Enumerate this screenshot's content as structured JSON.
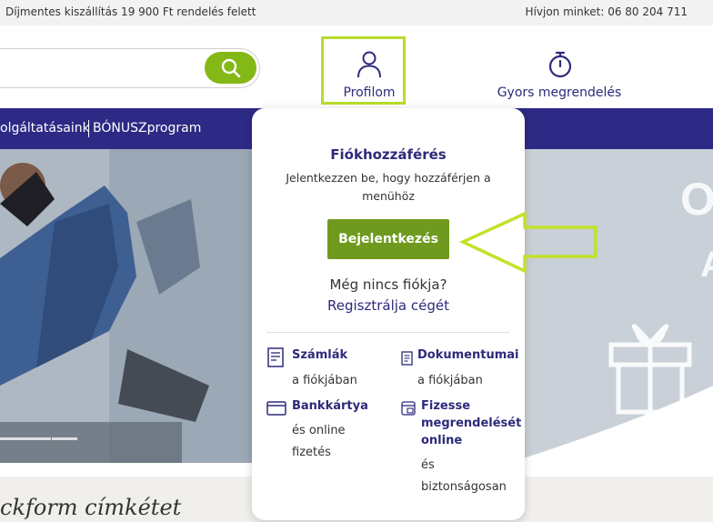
{
  "topbar": {
    "shipping": "Díjmentes kiszállítás 19 900 Ft rendelés felett",
    "phone": "Hívjon minket: 06 80 204 711"
  },
  "header": {
    "profile_label": "Profilom",
    "quick_order_label": "Gyors megrendelés"
  },
  "nav": {
    "item1": "olgáltatásaink",
    "item2": "BÓNUSZprogram"
  },
  "hero": {
    "text_fragment": "ckform címkétet"
  },
  "dropdown": {
    "title": "Fiókhozzáférés",
    "subtitle": "Jelentkezzen be, hogy hozzáférjen a menühöz",
    "login_button": "Bejelentkezés",
    "no_account": "Még nincs fiókja?",
    "register": "Regisztrálja cégét",
    "items": [
      {
        "title": "Számlák",
        "sub": "a fiókjában",
        "icon": "invoice-icon"
      },
      {
        "title": "Dokumentumai",
        "sub": "a fiókjában",
        "icon": "documents-icon"
      },
      {
        "title": "Bankkártya",
        "sub": "és online fizetés",
        "sub1": "és online",
        "sub2": "fizetés",
        "icon": "credit-card-icon"
      },
      {
        "title": "Fizesse megrendelését online",
        "t1": "Fizesse",
        "t2": "megrendelését",
        "t3": "online",
        "sub1": "és",
        "sub2": "biztonságosan",
        "icon": "online-payment-icon"
      }
    ]
  },
  "colors": {
    "brand_navy": "#2d2a85",
    "brand_green": "#84b817",
    "highlight": "#b8dc2a",
    "login_green": "#6f9a1f"
  }
}
